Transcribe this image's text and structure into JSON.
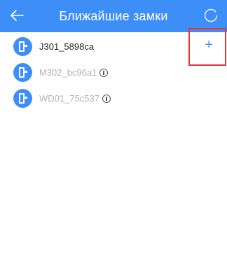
{
  "header": {
    "title": "Ближайшие замки",
    "color": "#3e8ef7"
  },
  "locks": [
    {
      "name": "J301_5898ca",
      "status": "available",
      "action": "+"
    },
    {
      "name": "M302_bc96a1",
      "status": "unavailable"
    },
    {
      "name": "WD01_75c537",
      "status": "unavailable"
    }
  ],
  "colors": {
    "accent": "#3e8ef7",
    "highlight": "#e8343b"
  }
}
